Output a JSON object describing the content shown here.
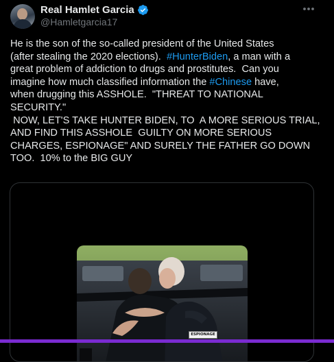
{
  "author": {
    "display_name": "Real Hamlet Garcia",
    "handle": "@Hamletgarcia17",
    "verified": true
  },
  "more_menu_icon": "more-horizontal-icon",
  "tweet": {
    "segments": [
      {
        "text": "He is the son of the so-called president of the United States\n(after stealing the 2020 elections).  ",
        "hashtag": false
      },
      {
        "text": "#HunterBiden",
        "hashtag": true
      },
      {
        "text": ", a man with a\ngreat problem of addiction to drugs and prostitutes.  Can you\nimagine how much classified information the ",
        "hashtag": false
      },
      {
        "text": "#Chinese",
        "hashtag": true
      },
      {
        "text": " have,\nwhen drugging this ASSHOLE.  \"THREAT TO NATIONAL\nSECURITY.\"\n NOW, LET'S TAKE HUNTER BIDEN, TO  A MORE SERIOUS TRIAL,\nAND FIND THIS ASSHOLE  GUILTY ON MORE SERIOUS\nCHARGES, ESPIONAGE\" AND SURELY THE FATHER GO DOWN\nTOO.  10% to the BIG GUY",
        "hashtag": false
      }
    ]
  },
  "media": {
    "kind": "photo",
    "stamp_label": "ESPIONAGE"
  },
  "colors": {
    "background": "#000000",
    "text": "#e7e9ea",
    "secondary": "#71767b",
    "link": "#1d9bf0",
    "verified": "#1d9bf0",
    "border": "#2f3336"
  }
}
